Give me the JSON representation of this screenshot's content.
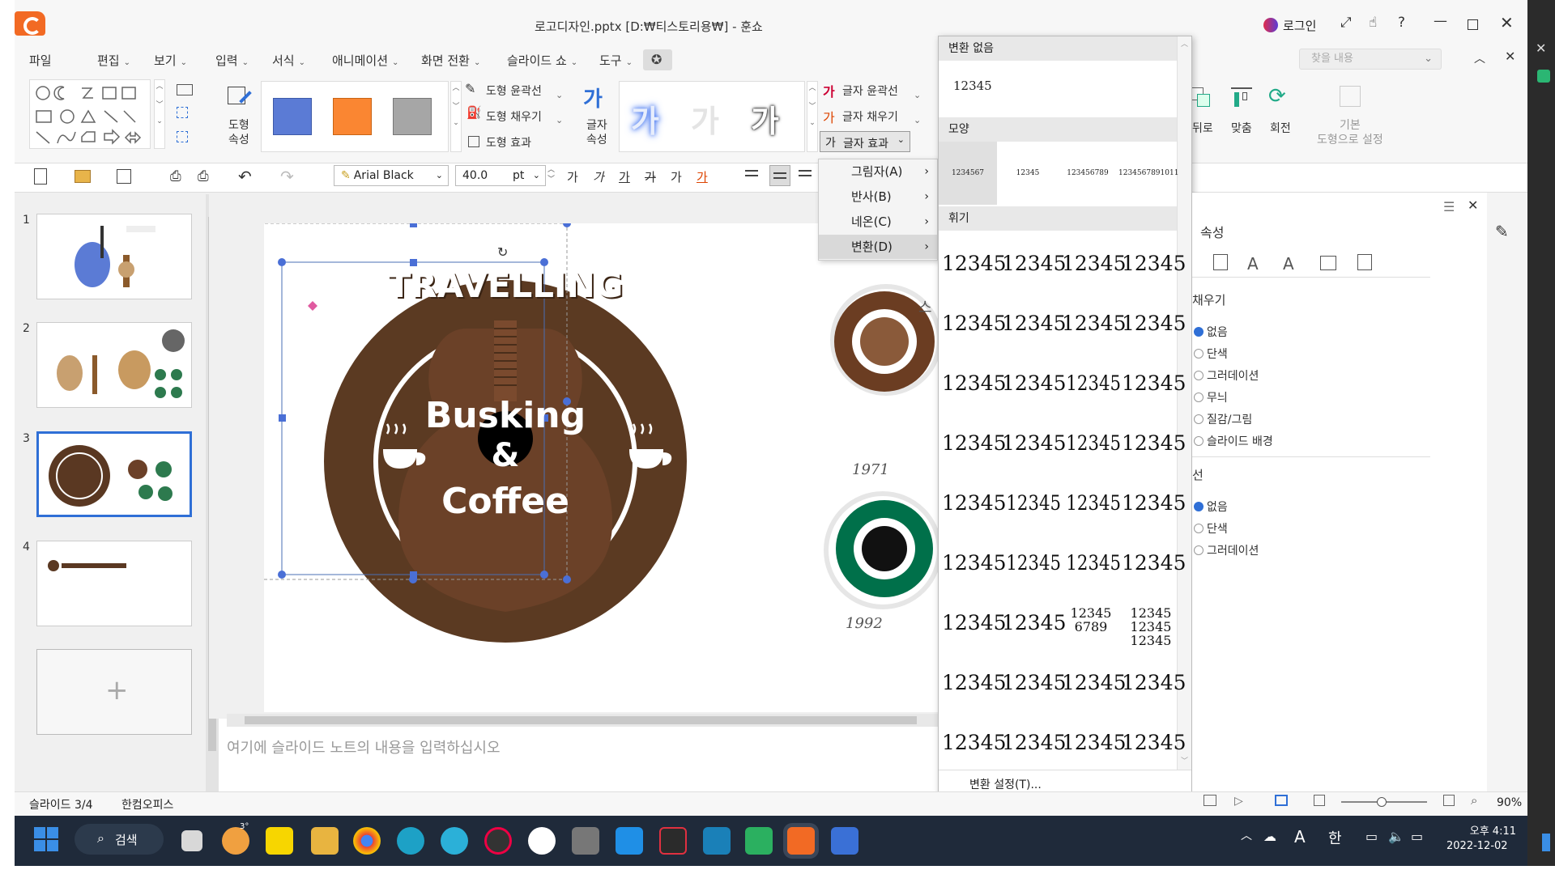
{
  "window": {
    "title": "로고디자인.pptx [D:₩티스토리용₩] - 훈쇼",
    "login": "로그인"
  },
  "menu": [
    {
      "label": "파일",
      "chev": ""
    },
    {
      "label": "편집",
      "chev": "⌄"
    },
    {
      "label": "보기",
      "chev": "⌄"
    },
    {
      "label": "입력",
      "chev": "⌄"
    },
    {
      "label": "서식",
      "chev": "⌄"
    },
    {
      "label": "애니메이션",
      "chev": "⌄"
    },
    {
      "label": "화면 전환",
      "chev": "⌄"
    },
    {
      "label": "슬라이드 쇼",
      "chev": "⌄"
    },
    {
      "label": "도구",
      "chev": "⌄"
    }
  ],
  "search": {
    "placeholder": "찾을 내용"
  },
  "ribbon": {
    "shape_props": "도형\n속성",
    "shape_outline": "도형 윤곽선",
    "shape_fill": "도형 채우기",
    "shape_effect": "도형 효과",
    "text_props": "글자\n속성",
    "text_outline": "글자 윤곽선",
    "text_fill": "글자 채우기",
    "text_effect": "글자 효과",
    "wordart_sample": "가",
    "back": "뒤로",
    "fit": "맞춤",
    "rotate": "회전",
    "default_shape": "기본\n도형으로 설정",
    "colors": {
      "blue": "#5b7bd5",
      "orange": "#fa8632",
      "gray": "#a6a6a6"
    }
  },
  "toolbar": {
    "font": "Arial Black",
    "size": "40.0",
    "unit": "pt",
    "fmt": [
      "가",
      "가",
      "가",
      "가",
      "가",
      "가"
    ]
  },
  "thumbnails": [
    {
      "num": "1"
    },
    {
      "num": "2"
    },
    {
      "num": "3"
    },
    {
      "num": "4"
    }
  ],
  "slide": {
    "logo_top": "TRAVELLING",
    "logo_mid": "Busking",
    "logo_amp": "&",
    "logo_bot": "Coffee",
    "year1": "1971",
    "year2": "1992",
    "partial": "스"
  },
  "notes": {
    "placeholder": "여기에 슬라이드 노트의 내용을 입력하십시오"
  },
  "submenu": [
    {
      "label": "그림자(A)"
    },
    {
      "label": "반사(B)"
    },
    {
      "label": "네온(C)"
    },
    {
      "label": "변환(D)"
    }
  ],
  "gallery": {
    "no_transform": "변환 없음",
    "sample": "12345",
    "shape": "모양",
    "warp": "휘기",
    "settings": "변환 설정(T)...",
    "shape_samples": [
      "1234567",
      "12345",
      "123456789",
      "1234567891011"
    ],
    "warp_samples": [
      "12345",
      "12345",
      "12345",
      "12345",
      "12345",
      "12345",
      "12345",
      "12345",
      "12345",
      "12345",
      "12345",
      "12345",
      "12345",
      "12345",
      "12345",
      "12345",
      "12345",
      "12345",
      "12345",
      "12345",
      "12345",
      "12345",
      "12345",
      "12345",
      "12345",
      "12345",
      "12345\n6789",
      "12345\n12345\n12345",
      "12345",
      "12345",
      "12345",
      "12345",
      "12345",
      "12345",
      "12345",
      "12345"
    ]
  },
  "panel": {
    "title": "속성",
    "fill_title": "채우기",
    "fill_opts": [
      "없음",
      "단색",
      "그러데이션",
      "무늬",
      "질감/그림",
      "슬라이드 배경"
    ],
    "line_title": "선",
    "line_opts": [
      "없음",
      "단색",
      "그러데이션"
    ]
  },
  "status": {
    "slide": "슬라이드 3/4",
    "app": "한컴오피스",
    "zoom": "90%"
  },
  "taskbar": {
    "search": "검색",
    "time": "오후 4:11",
    "date": "2022-12-02",
    "lang": "한",
    "ime": "A",
    "badge": "3°"
  }
}
